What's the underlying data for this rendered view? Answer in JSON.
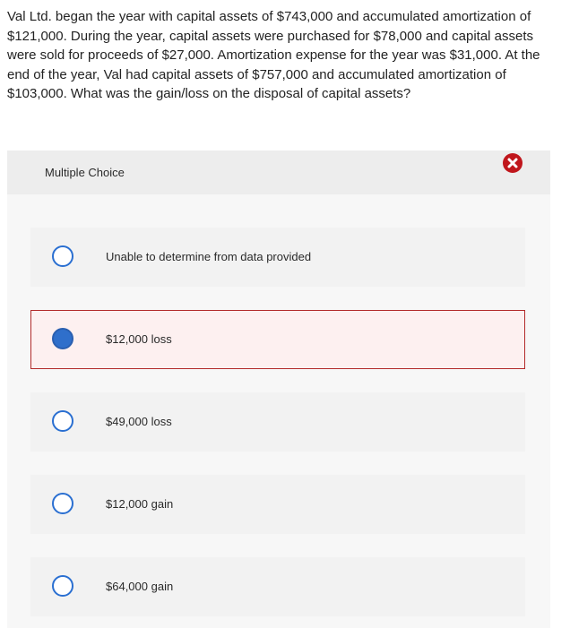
{
  "question": {
    "text": "Val Ltd. began the year with capital assets of $743,000 and accumulated amortization of $121,000. During the year, capital assets were purchased for $78,000 and capital assets were sold for proceeds of $27,000. Amortization expense for the year was $31,000. At the end of the year, Val had capital assets of $757,000 and accumulated amortization of $103,000. What was the gain/loss on the disposal of capital assets?"
  },
  "multiple_choice": {
    "title": "Multiple Choice",
    "options": [
      {
        "label": "Unable to determine from data provided",
        "selected": false
      },
      {
        "label": "$12,000 loss",
        "selected": true,
        "status": "incorrect"
      },
      {
        "label": "$49,000 loss",
        "selected": false
      },
      {
        "label": "$12,000 gain",
        "selected": false
      },
      {
        "label": "$64,000 gain",
        "selected": false
      }
    ]
  },
  "icons": {
    "incorrect_mark": "x-circle-icon"
  },
  "colors": {
    "radio_border": "#2a6fd1",
    "radio_selected_fill": "#2f6fcb",
    "incorrect_border": "#b22a2a",
    "incorrect_bg": "#fdf0f0",
    "incorrect_icon": "#c0161c"
  }
}
